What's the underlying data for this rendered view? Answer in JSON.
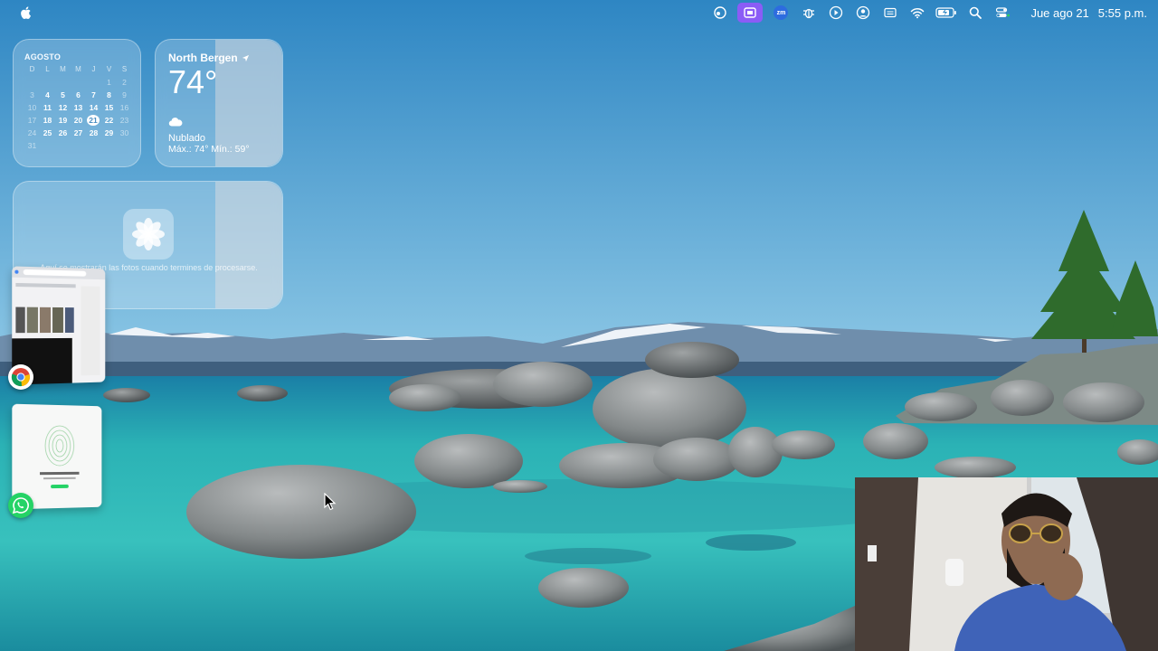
{
  "menubar": {
    "date": "Jue ago 21",
    "time": "5:55 p.m.",
    "zoom_label": "zm"
  },
  "calendar": {
    "month": "AGOSTO",
    "weekdays": [
      "D",
      "L",
      "M",
      "M",
      "J",
      "V",
      "S"
    ],
    "weeks": [
      [
        "",
        "",
        "",
        "",
        "",
        "1",
        "2"
      ],
      [
        "3",
        "4",
        "5",
        "6",
        "7",
        "8",
        "9"
      ],
      [
        "10",
        "11",
        "12",
        "13",
        "14",
        "15",
        "16"
      ],
      [
        "17",
        "18",
        "19",
        "20",
        "21",
        "22",
        "23"
      ],
      [
        "24",
        "25",
        "26",
        "27",
        "28",
        "29",
        "30"
      ],
      [
        "31",
        "",
        "",
        "",
        "",
        "",
        ""
      ]
    ],
    "today": "21"
  },
  "weather": {
    "city": "North Bergen",
    "temperature": "74°",
    "condition": "Nublado",
    "high_low": "Máx.: 74° Mín.: 59°"
  },
  "photos": {
    "message": "Aquí se mostrarán las fotos cuando termines de procesarse."
  },
  "colors": {
    "sky_top": "#2f86c2",
    "sky_bottom": "#8cc6e4",
    "lake": "#1e9fa6",
    "accent_menu": "#8b5cf6",
    "whatsapp": "#25d366"
  }
}
